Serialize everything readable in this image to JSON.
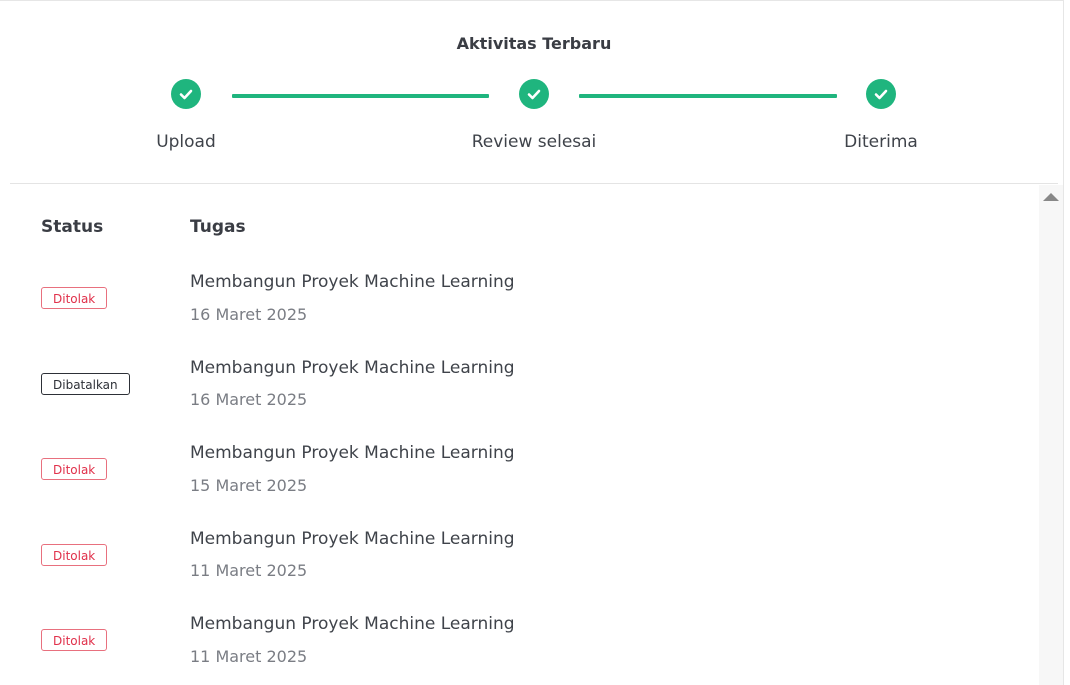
{
  "title": "Aktivitas Terbaru",
  "colors": {
    "accent": "#1fb57e",
    "rejected": "#e0304a",
    "cancelled": "#2d3037"
  },
  "stepper": {
    "steps": [
      {
        "label": "Upload",
        "icon": "check-icon",
        "completed": true
      },
      {
        "label": "Review selesai",
        "icon": "check-icon",
        "completed": true
      },
      {
        "label": "Diterima",
        "icon": "check-icon",
        "completed": true
      }
    ]
  },
  "table": {
    "headers": {
      "status": "Status",
      "task": "Tugas"
    },
    "rows": [
      {
        "status": "Ditolak",
        "status_type": "rejected",
        "title": "Membangun Proyek Machine Learning",
        "date": "16 Maret 2025"
      },
      {
        "status": "Dibatalkan",
        "status_type": "cancelled",
        "title": "Membangun Proyek Machine Learning",
        "date": "16 Maret 2025"
      },
      {
        "status": "Ditolak",
        "status_type": "rejected",
        "title": "Membangun Proyek Machine Learning",
        "date": "15 Maret 2025"
      },
      {
        "status": "Ditolak",
        "status_type": "rejected",
        "title": "Membangun Proyek Machine Learning",
        "date": "11 Maret 2025"
      },
      {
        "status": "Ditolak",
        "status_type": "rejected",
        "title": "Membangun Proyek Machine Learning",
        "date": "11 Maret 2025"
      }
    ]
  }
}
